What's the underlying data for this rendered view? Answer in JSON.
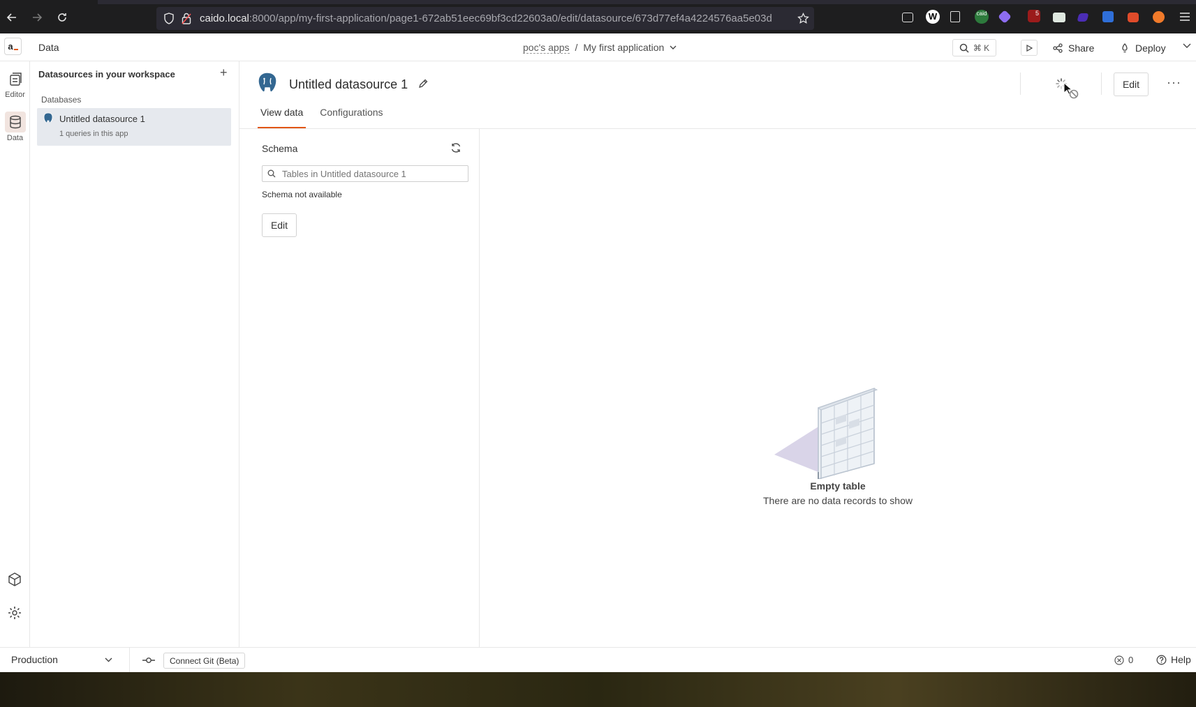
{
  "browser": {
    "url_host": "caido.local",
    "url_rest": ":8000/app/my-first-application/page1-672ab51eec69bf3cd22603a0/edit/datasource/673d77ef4a4224576aa5e03d",
    "extensions": [
      "pocket-icon",
      "w-icon",
      "puzzle-icon",
      "caido-icon",
      "purple-diamond-icon",
      "red-badge-icon",
      "green-icon",
      "violet-icon",
      "blue-icon",
      "fox-icon",
      "orange-icon",
      "menu-icon"
    ],
    "ext_badge_1": "caid",
    "ext_badge_2": "5"
  },
  "topbar": {
    "title": "Data",
    "workspace": "poc's apps",
    "separator": "/",
    "app_name": "My first application",
    "search_shortcut": "⌘ K",
    "share_label": "Share",
    "deploy_label": "Deploy"
  },
  "rail": {
    "editor_label": "Editor",
    "data_label": "Data"
  },
  "datasources_panel": {
    "title": "Datasources in your workspace",
    "add_symbol": "+",
    "section_label": "Databases",
    "items": [
      {
        "name": "Untitled datasource 1",
        "subtitle": "1 queries in this app"
      }
    ]
  },
  "main": {
    "title": "Untitled datasource 1",
    "edit_label": "Edit",
    "more_label": "···",
    "tabs": [
      {
        "label": "View data",
        "active": true
      },
      {
        "label": "Configurations",
        "active": false
      }
    ],
    "schema": {
      "title": "Schema",
      "search_placeholder": "Tables in Untitled datasource 1",
      "empty_text": "Schema not available",
      "edit_label": "Edit"
    },
    "empty_state": {
      "title": "Empty table",
      "subtitle": "There are no data records to show"
    }
  },
  "bottombar": {
    "environment": "Production",
    "git_label": "Connect Git (Beta)",
    "error_count": "0",
    "help_label": "Help"
  },
  "colors": {
    "accent": "#e15615",
    "selected_bg": "#e6e9ee",
    "browser_bg": "#1e1e1f",
    "postgres_blue": "#336791"
  }
}
